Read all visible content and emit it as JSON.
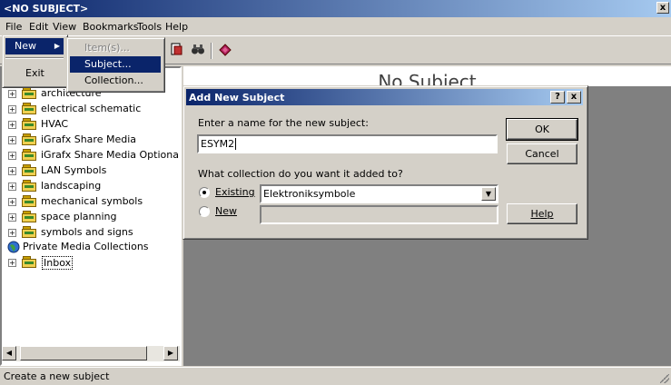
{
  "window": {
    "title": "<NO SUBJECT>",
    "close_label": "x"
  },
  "menubar": [
    "File",
    "Edit",
    "View",
    "Bookmarks",
    "Tools",
    "Help"
  ],
  "file_menu": {
    "new_label": "New",
    "exit_label": "Exit"
  },
  "new_submenu": {
    "items": [
      "Item(s)...",
      "Subject...",
      "Collection..."
    ]
  },
  "tree": {
    "items": [
      "architecture",
      "electrical schematic",
      "HVAC",
      "iGrafx Share Media",
      "iGrafx Share Media Optiona",
      "LAN Symbols",
      "landscaping",
      "mechanical symbols",
      "space planning",
      "symbols and signs"
    ],
    "private_root": "Private Media Collections",
    "inbox": "Inbox"
  },
  "main": {
    "title": "No Subject"
  },
  "dialog": {
    "title": "Add New Subject",
    "help_btn": "?",
    "close_btn": "x",
    "name_prompt": "Enter a name for the new subject:",
    "name_value": "ESYM2",
    "collection_prompt": "What collection do you want it added to?",
    "existing_label": "Existing",
    "new_label": "New",
    "existing_value": "Elektroniksymbole",
    "ok": "OK",
    "cancel": "Cancel",
    "help": "Help",
    "selected_option": "Existing"
  },
  "status": {
    "text": "Create a new subject"
  },
  "colors": {
    "title_active": "#0a246a",
    "face": "#d4d0c8",
    "pane": "#808080"
  },
  "icons": [
    "document-icon",
    "binoculars-icon",
    "book-icon",
    "folder-icon",
    "globe-icon"
  ]
}
